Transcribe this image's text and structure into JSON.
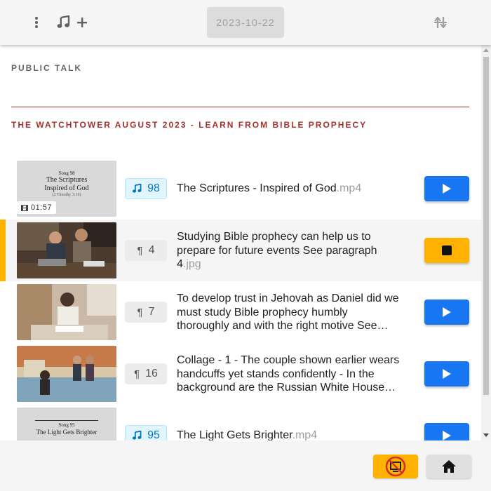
{
  "header": {
    "date": "2023-10-22",
    "icons": [
      "more-vertical-icon",
      "music-note-icon",
      "plus-icon",
      "sort-swap-icon"
    ]
  },
  "sections": {
    "public_talk": "PUBLIC TALK",
    "watchtower": "THE WATCHTOWER AUGUST 2023 - LEARN FROM BIBLE PROPHECY"
  },
  "items": [
    {
      "badge_type": "song",
      "badge_number": "98",
      "title": "The Scriptures - Inspired of God",
      "ext": ".mp4",
      "duration": "01:57",
      "thumb_lines": [
        "Song 98",
        "The Scriptures",
        "Inspired of God",
        "(2 Timothy 3:16)"
      ],
      "state": "ready"
    },
    {
      "badge_type": "paragraph",
      "badge_number": "4",
      "title": "Studying Bible prophecy can help us to prepare for future events See paragraph 4",
      "ext": ".jpg",
      "state": "playing"
    },
    {
      "badge_type": "paragraph",
      "badge_number": "7",
      "title": "To develop trust in Jehovah as Daniel did we must study Bible prophecy humbly thoroughly and with the right motive See…",
      "ext": "",
      "state": "ready"
    },
    {
      "badge_type": "paragraph",
      "badge_number": "16",
      "title": "Collage - 1 -  The couple shown earlier wears handcuffs yet stands confidently - In the background are the Russian White House…",
      "ext": "",
      "state": "ready"
    },
    {
      "badge_type": "song",
      "badge_number": "95",
      "title": "The Light Gets Brighter",
      "ext": ".mp4",
      "thumb_lines": [
        "Song 95",
        "The Light Gets Brighter"
      ],
      "state": "ready"
    }
  ],
  "colors": {
    "accent_blue": "#1976f2",
    "accent_amber": "#ffb300",
    "section_red": "#a3302f"
  },
  "footer": {
    "icons": [
      "media-window-off-icon",
      "home-icon"
    ]
  }
}
